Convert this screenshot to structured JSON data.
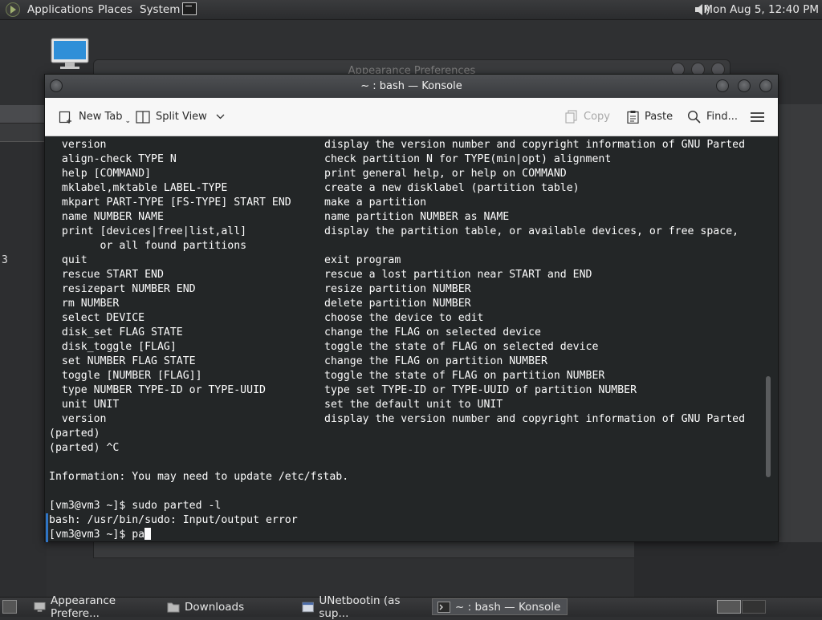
{
  "top_panel": {
    "menus": [
      "Applications",
      "Places",
      "System"
    ],
    "clock": "Mon Aug  5, 12:40 PM"
  },
  "background": {
    "left_window_text": "3",
    "appearance_window_title": "Appearance Preferences"
  },
  "konsole": {
    "title": "~ : bash — Konsole",
    "toolbar": {
      "new_tab": "New Tab",
      "split_view": "Split View",
      "copy": "Copy",
      "paste": "Paste",
      "find": "Find..."
    },
    "help_lines": [
      [
        "  version",
        "display the version number and copyright information of GNU Parted"
      ],
      [
        "  align-check TYPE N",
        "check partition N for TYPE(min|opt) alignment"
      ],
      [
        "  help [COMMAND]",
        "print general help, or help on COMMAND"
      ],
      [
        "  mklabel,mktable LABEL-TYPE",
        "create a new disklabel (partition table)"
      ],
      [
        "  mkpart PART-TYPE [FS-TYPE] START END",
        "make a partition"
      ],
      [
        "  name NUMBER NAME",
        "name partition NUMBER as NAME"
      ],
      [
        "  print [devices|free|list,all]",
        "display the partition table, or available devices, or free space,"
      ],
      [
        "        or all found partitions",
        ""
      ],
      [
        "  quit",
        "exit program"
      ],
      [
        "  rescue START END",
        "rescue a lost partition near START and END"
      ],
      [
        "  resizepart NUMBER END",
        "resize partition NUMBER"
      ],
      [
        "  rm NUMBER",
        "delete partition NUMBER"
      ],
      [
        "  select DEVICE",
        "choose the device to edit"
      ],
      [
        "  disk_set FLAG STATE",
        "change the FLAG on selected device"
      ],
      [
        "  disk_toggle [FLAG]",
        "toggle the state of FLAG on selected device"
      ],
      [
        "  set NUMBER FLAG STATE",
        "change the FLAG on partition NUMBER"
      ],
      [
        "  toggle [NUMBER [FLAG]]",
        "toggle the state of FLAG on partition NUMBER"
      ],
      [
        "  type NUMBER TYPE-ID or TYPE-UUID",
        "type set TYPE-ID or TYPE-UUID of partition NUMBER"
      ],
      [
        "  unit UNIT",
        "set the default unit to UNIT"
      ],
      [
        "  version",
        "display the version number and copyright information of GNU Parted"
      ]
    ],
    "tail_lines": [
      "(parted)",
      "(parted) ^C",
      "",
      "Information: You may need to update /etc/fstab.",
      "",
      "[vm3@vm3 ~]$ sudo parted -l",
      "bash: /usr/bin/sudo: Input/output error",
      "[vm3@vm3 ~]$ pa"
    ]
  },
  "taskbar": {
    "tasks": [
      "Appearance Prefere...",
      "Downloads",
      "UNetbootin (as sup...",
      "~ : bash — Konsole"
    ]
  },
  "colors": {
    "terminal_bg": "#232627",
    "terminal_fg": "#fcfcfc",
    "prompt_marker": "#2f74c4",
    "panel_bg": "#2b2c2e"
  }
}
